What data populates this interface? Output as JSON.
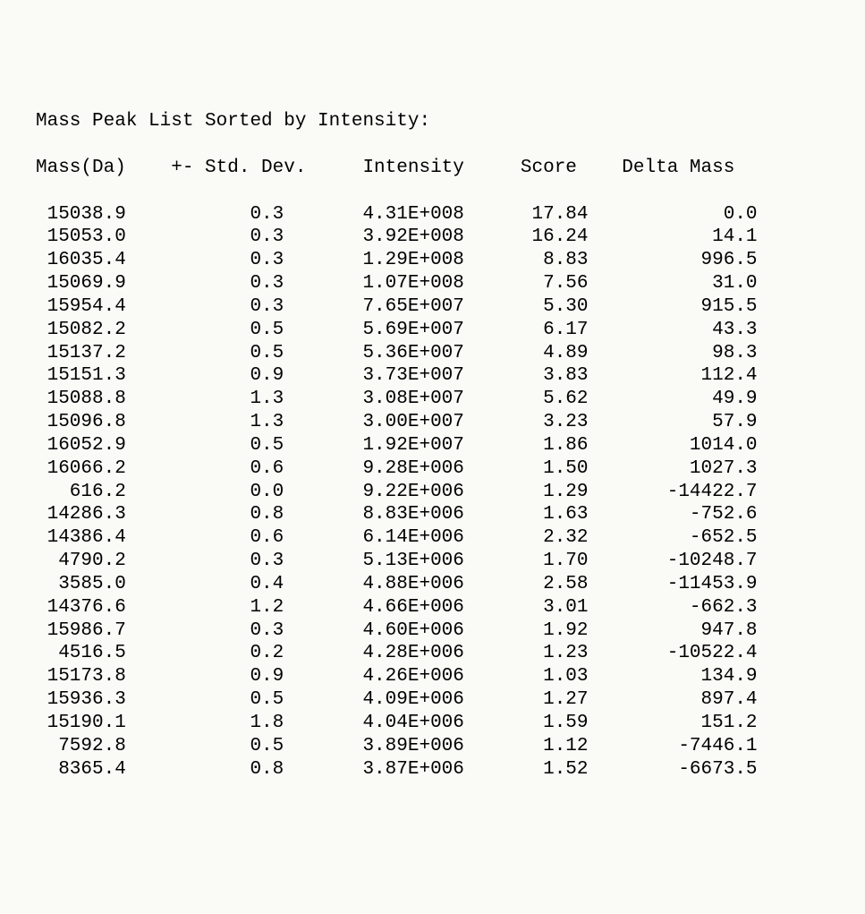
{
  "title": "Mass Peak List Sorted by Intensity:",
  "headers": {
    "mass": "Mass(Da)",
    "std": "+- Std. Dev.",
    "intensity": "Intensity",
    "score": "Score",
    "delta": "Delta Mass"
  },
  "chart_data": {
    "type": "table",
    "title": "Mass Peak List Sorted by Intensity",
    "columns": [
      "Mass(Da)",
      "+- Std. Dev.",
      "Intensity",
      "Score",
      "Delta Mass"
    ],
    "rows": [
      {
        "mass": 15038.9,
        "std": 0.3,
        "intensity": "4.31E+008",
        "score": 17.84,
        "delta": 0.0
      },
      {
        "mass": 15053.0,
        "std": 0.3,
        "intensity": "3.92E+008",
        "score": 16.24,
        "delta": 14.1
      },
      {
        "mass": 16035.4,
        "std": 0.3,
        "intensity": "1.29E+008",
        "score": 8.83,
        "delta": 996.5
      },
      {
        "mass": 15069.9,
        "std": 0.3,
        "intensity": "1.07E+008",
        "score": 7.56,
        "delta": 31.0
      },
      {
        "mass": 15954.4,
        "std": 0.3,
        "intensity": "7.65E+007",
        "score": 5.3,
        "delta": 915.5
      },
      {
        "mass": 15082.2,
        "std": 0.5,
        "intensity": "5.69E+007",
        "score": 6.17,
        "delta": 43.3
      },
      {
        "mass": 15137.2,
        "std": 0.5,
        "intensity": "5.36E+007",
        "score": 4.89,
        "delta": 98.3
      },
      {
        "mass": 15151.3,
        "std": 0.9,
        "intensity": "3.73E+007",
        "score": 3.83,
        "delta": 112.4
      },
      {
        "mass": 15088.8,
        "std": 1.3,
        "intensity": "3.08E+007",
        "score": 5.62,
        "delta": 49.9
      },
      {
        "mass": 15096.8,
        "std": 1.3,
        "intensity": "3.00E+007",
        "score": 3.23,
        "delta": 57.9
      },
      {
        "mass": 16052.9,
        "std": 0.5,
        "intensity": "1.92E+007",
        "score": 1.86,
        "delta": 1014.0
      },
      {
        "mass": 16066.2,
        "std": 0.6,
        "intensity": "9.28E+006",
        "score": 1.5,
        "delta": 1027.3
      },
      {
        "mass": 616.2,
        "std": 0.0,
        "intensity": "9.22E+006",
        "score": 1.29,
        "delta": -14422.7
      },
      {
        "mass": 14286.3,
        "std": 0.8,
        "intensity": "8.83E+006",
        "score": 1.63,
        "delta": -752.6
      },
      {
        "mass": 14386.4,
        "std": 0.6,
        "intensity": "6.14E+006",
        "score": 2.32,
        "delta": -652.5
      },
      {
        "mass": 4790.2,
        "std": 0.3,
        "intensity": "5.13E+006",
        "score": 1.7,
        "delta": -10248.7
      },
      {
        "mass": 3585.0,
        "std": 0.4,
        "intensity": "4.88E+006",
        "score": 2.58,
        "delta": -11453.9
      },
      {
        "mass": 14376.6,
        "std": 1.2,
        "intensity": "4.66E+006",
        "score": 3.01,
        "delta": -662.3
      },
      {
        "mass": 15986.7,
        "std": 0.3,
        "intensity": "4.60E+006",
        "score": 1.92,
        "delta": 947.8
      },
      {
        "mass": 4516.5,
        "std": 0.2,
        "intensity": "4.28E+006",
        "score": 1.23,
        "delta": -10522.4
      },
      {
        "mass": 15173.8,
        "std": 0.9,
        "intensity": "4.26E+006",
        "score": 1.03,
        "delta": 134.9
      },
      {
        "mass": 15936.3,
        "std": 0.5,
        "intensity": "4.09E+006",
        "score": 1.27,
        "delta": 897.4
      },
      {
        "mass": 15190.1,
        "std": 1.8,
        "intensity": "4.04E+006",
        "score": 1.59,
        "delta": 151.2
      },
      {
        "mass": 7592.8,
        "std": 0.5,
        "intensity": "3.89E+006",
        "score": 1.12,
        "delta": -7446.1
      },
      {
        "mass": 8365.4,
        "std": 0.8,
        "intensity": "3.87E+006",
        "score": 1.52,
        "delta": -6673.5
      }
    ]
  }
}
